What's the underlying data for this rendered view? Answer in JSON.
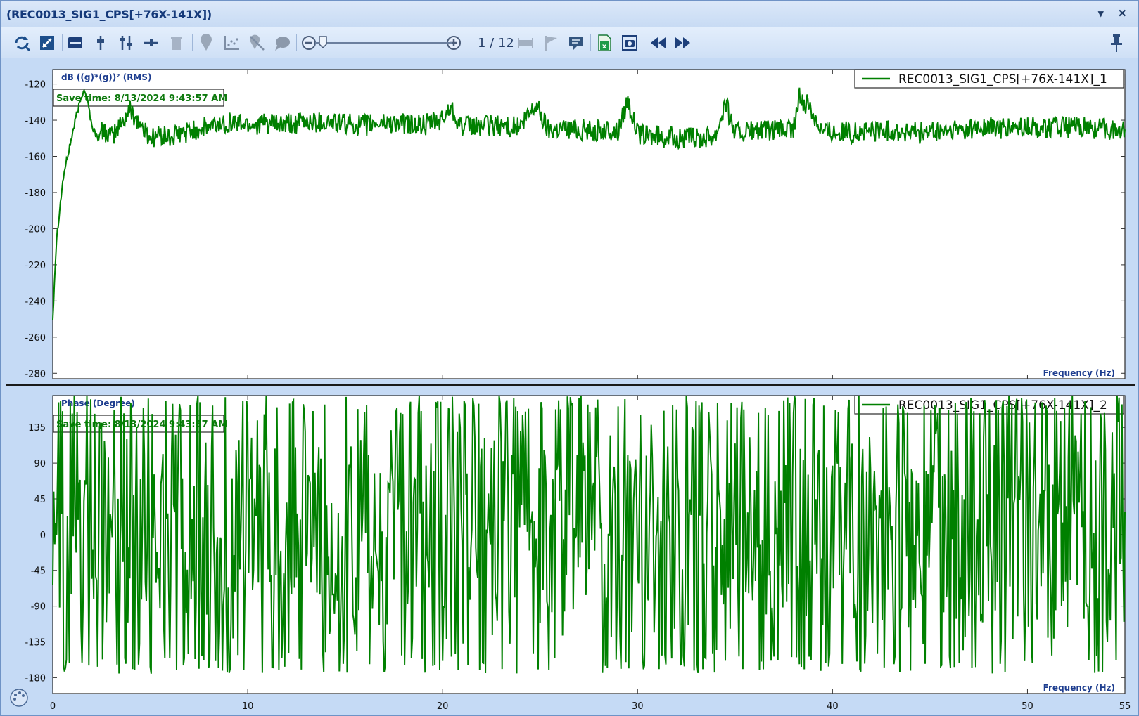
{
  "window": {
    "title": "(REC0013_SIG1_CPS[+76X-141X])",
    "dropdown_label": "▾",
    "close_label": "✕"
  },
  "toolbar": {
    "icons": [
      "refresh-zoom-icon",
      "fit-icon",
      "layout-icon",
      "cursor-single-icon",
      "cursor-dual-icon",
      "cursor-horizontal-icon",
      "delete-cursor-icon",
      "marker-icon",
      "scatter-icon",
      "hide-marker-icon",
      "comment-icon",
      "zoom-out-icon",
      "zoom-in-icon",
      "range-icon",
      "flag-icon",
      "annotate-icon",
      "excel-export-icon",
      "screenshot-icon",
      "previous-icon",
      "next-icon",
      "pin-icon"
    ],
    "page_indicator": "1 / 12"
  },
  "colors": {
    "trace": "#008000",
    "axis_label": "#1d3d8f",
    "save_time": "#0e7a0e",
    "frame": "#6f93c6"
  },
  "chart_data": [
    {
      "type": "line",
      "ylabel": "dB ((g)*(g))² (RMS)",
      "xlabel": "Frequency (Hz)",
      "legend": "REC0013_SIG1_CPS[+76X-141X]_1",
      "legend_position": "top-right",
      "save_time": "Save time: 8/13/2024 9:43:57 AM",
      "xlim": [
        0,
        55
      ],
      "ylim": [
        -283,
        -112
      ],
      "yticks": [
        -120,
        -140,
        -160,
        -180,
        -200,
        -220,
        -240,
        -260,
        -280
      ],
      "xticks": [
        0,
        10,
        20,
        30,
        40,
        50,
        55
      ],
      "grid": false,
      "x": [
        0,
        0.1,
        0.2,
        0.3,
        0.4,
        0.5,
        0.6,
        0.8,
        1.0,
        1.2,
        1.4,
        1.6,
        1.8,
        2.0,
        2.3,
        2.6,
        3.0,
        3.5,
        4.0,
        4.5,
        5.0,
        5.5,
        6.0,
        7.0,
        8.0,
        9.0,
        10.0,
        11.0,
        12.0,
        13.0,
        14.0,
        15.0,
        16.0,
        17.0,
        18.0,
        19.0,
        20.0,
        20.4,
        21.0,
        22.0,
        23.0,
        24.0,
        24.8,
        25.4,
        26.0,
        27.0,
        28.0,
        29.0,
        29.5,
        30.0,
        31.0,
        32.0,
        33.0,
        34.0,
        34.5,
        35.0,
        36.0,
        37.0,
        38.0,
        38.3,
        38.8,
        39.5,
        40.0,
        41.0,
        42.0,
        43.0,
        44.0,
        45.0,
        46.0,
        47.0,
        48.0,
        49.0,
        50.0,
        51.0,
        52.0,
        53.0,
        54.0,
        55.0
      ],
      "values": [
        -250,
        -225,
        -205,
        -195,
        -185,
        -175,
        -168,
        -158,
        -148,
        -138,
        -130,
        -122,
        -130,
        -143,
        -150,
        -145,
        -150,
        -142,
        -134,
        -143,
        -150,
        -148,
        -150,
        -146,
        -144,
        -141,
        -142,
        -142,
        -143,
        -141,
        -141,
        -142,
        -143,
        -141,
        -142,
        -143,
        -140,
        -132,
        -144,
        -143,
        -143,
        -144,
        -131,
        -145,
        -144,
        -145,
        -146,
        -146,
        -128,
        -148,
        -149,
        -150,
        -150,
        -148,
        -130,
        -147,
        -146,
        -146,
        -145,
        -128,
        -132,
        -146,
        -146,
        -147,
        -146,
        -146,
        -147,
        -147,
        -146,
        -145,
        -144,
        -145,
        -144,
        -144,
        -144,
        -144,
        -145,
        -145
      ]
    },
    {
      "type": "line",
      "ylabel": "Phase (Degree)",
      "xlabel": "Frequency (Hz)",
      "legend": "REC0013_SIG1_CPS[+76X-141X]_2",
      "legend_position": "top-right",
      "save_time": "Save time: 8/13/2024 9:43:57 AM",
      "xlim": [
        0,
        55
      ],
      "ylim": [
        -200,
        175
      ],
      "yticks": [
        135,
        90,
        45,
        0,
        -45,
        -90,
        -135,
        -180
      ],
      "xticks": [
        0,
        10,
        20,
        30,
        40,
        50,
        55
      ],
      "grid": false,
      "x": [
        0,
        0.5,
        1.0,
        1.5,
        2.0,
        2.5,
        3.0,
        4.0,
        5.0,
        6.0,
        7.0,
        8.0,
        9.0,
        10.0,
        11.0,
        12.0,
        13.0,
        14.0,
        15.0,
        16.0,
        17.0,
        18.0,
        19.0,
        20.0,
        21.0,
        22.0,
        23.0,
        24.0,
        25.0,
        26.0,
        27.0,
        28.0,
        29.0,
        30.0,
        31.0,
        32.0,
        33.0,
        34.0,
        35.0,
        36.0,
        37.0,
        38.0,
        39.0,
        40.0,
        41.0,
        42.0,
        43.0,
        44.0,
        45.0,
        46.0,
        47.0,
        48.0,
        49.0,
        50.0,
        51.0,
        52.0,
        53.0,
        54.0,
        55.0
      ],
      "values": [
        -60,
        160,
        -170,
        165,
        -175,
        140,
        -150,
        120,
        -165,
        155,
        -120,
        160,
        -140,
        130,
        -160,
        150,
        -130,
        165,
        -170,
        140,
        -155,
        160,
        -150,
        120,
        -165,
        155,
        -175,
        160,
        -140,
        150,
        -170,
        135,
        -160,
        160,
        -150,
        130,
        -175,
        155,
        -145,
        160,
        -170,
        140,
        -155,
        160,
        -165,
        150,
        -140,
        160,
        -175,
        150,
        -155,
        160,
        -150,
        140,
        -175,
        160,
        -160,
        155,
        -40
      ]
    }
  ]
}
